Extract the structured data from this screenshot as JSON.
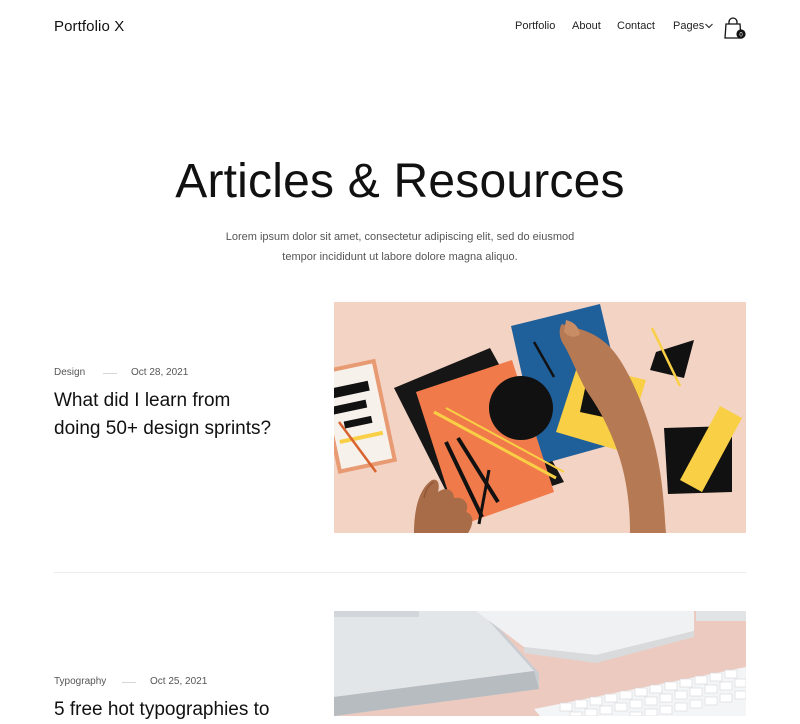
{
  "header": {
    "logo": "Portfolio X",
    "nav": [
      "Portfolio",
      "About",
      "Contact",
      "Pages"
    ],
    "cart_count": "0"
  },
  "hero": {
    "title": "Articles & Resources",
    "subtitle_line1": "Lorem ipsum dolor sit amet, consectetur adipiscing elit, sed do eiusmod",
    "subtitle_line2": "tempor incididunt ut labore dolore magna aliquo."
  },
  "posts": [
    {
      "category": "Design",
      "date": "Oct 28, 2021",
      "title_line1": "What did I learn from",
      "title_line2": "doing 50+ design sprints?"
    },
    {
      "category": "Typography",
      "date": "Oct 25, 2021",
      "title_line1": "5 free hot typographies to"
    }
  ],
  "colors": {
    "accent_blue": "#1f5f9a",
    "accent_orange": "#f07a4a",
    "accent_yellow": "#f8cf45",
    "peach": "#f3d3c4"
  }
}
